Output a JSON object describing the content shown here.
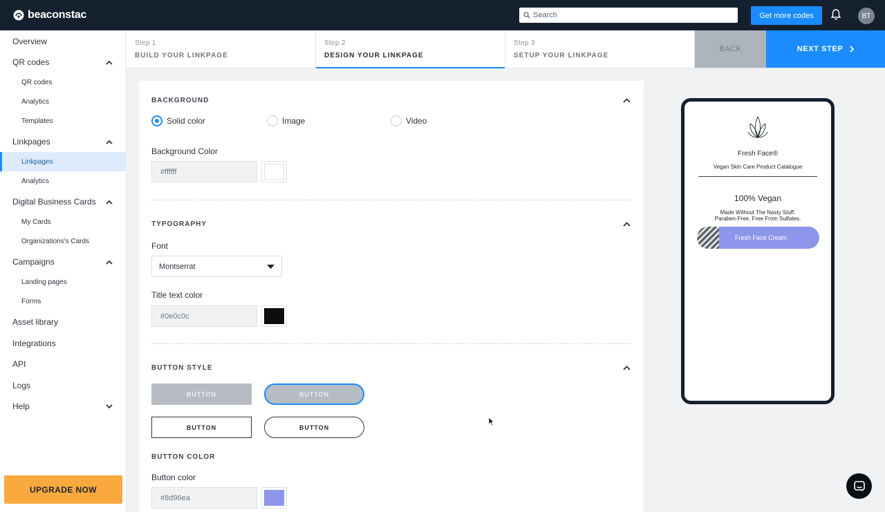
{
  "header": {
    "brand": "beaconstac",
    "search_placeholder": "Search",
    "cta": "Get more codes",
    "avatar_initials": "BT"
  },
  "sidebar": {
    "items": [
      {
        "label": "Overview"
      },
      {
        "label": "QR codes",
        "expanded": true
      },
      {
        "label": "QR codes"
      },
      {
        "label": "Analytics"
      },
      {
        "label": "Templates"
      },
      {
        "label": "Linkpages",
        "expanded": true
      },
      {
        "label": "Linkpages",
        "active": true
      },
      {
        "label": "Analytics"
      },
      {
        "label": "Digital Business Cards",
        "expanded": true
      },
      {
        "label": "My Cards"
      },
      {
        "label": "Organizations's Cards"
      },
      {
        "label": "Campaigns",
        "expanded": true
      },
      {
        "label": "Landing pages"
      },
      {
        "label": "Forms"
      },
      {
        "label": "Asset library"
      },
      {
        "label": "Integrations"
      },
      {
        "label": "API"
      },
      {
        "label": "Logs"
      },
      {
        "label": "Help",
        "expanded": false
      }
    ],
    "upgrade": "UPGRADE NOW"
  },
  "steps": {
    "items": [
      {
        "num": "Step 1",
        "label": "BUILD YOUR LINKPAGE"
      },
      {
        "num": "Step 2",
        "label": "DESIGN YOUR LINKPAGE",
        "current": true
      },
      {
        "num": "Step 3",
        "label": "SETUP YOUR LINKPAGE"
      }
    ],
    "back": "BACK",
    "next": "NEXT STEP"
  },
  "background": {
    "heading": "BACKGROUND",
    "options": [
      "Solid color",
      "Image",
      "Video"
    ],
    "selected": "Solid color",
    "color_label": "Background Color",
    "color_value": "#ffffff"
  },
  "typography": {
    "heading": "TYPOGRAPHY",
    "font_label": "Font",
    "font_value": "Montserrat",
    "title_color_label": "Title text color",
    "title_color_value": "#0e0c0c"
  },
  "button_style": {
    "heading": "BUTTON STYLE",
    "buttons": [
      "BUTTON",
      "BUTTON",
      "BUTTON",
      "BUTTON"
    ],
    "selected_index": 1
  },
  "button_color": {
    "heading": "BUTTON COLOR",
    "label": "Button color",
    "value": "#8d96ea"
  },
  "preview": {
    "brand": "Fresh Face®",
    "subtitle": "Vegan Skin Care Product Catalogue",
    "headline": "100% Vegan",
    "line1": "Made Without The Nasty Stuff.",
    "line2": "Paraben-Free. Free From Sulfates.",
    "button": "Fresh Face Cream"
  },
  "colors": {
    "accent": "#1a8cff",
    "topbar": "#15202f",
    "upgrade": "#f9a93e",
    "button_color": "#8d96ea",
    "title_color": "#0e0c0c"
  }
}
